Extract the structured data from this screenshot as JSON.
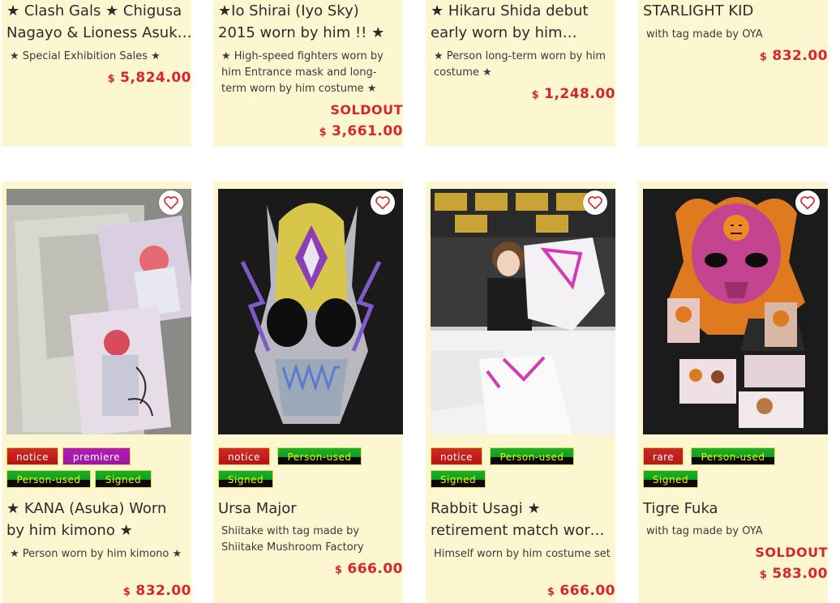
{
  "currency_symbol": "$",
  "top_row": [
    {
      "title": "★ Clash Gals ★ Chigusa Nagayo & Lioness Asuk…",
      "desc": "★ Special Exhibition Sales ★",
      "soldout": "",
      "price": "5,824.00"
    },
    {
      "title": "★Io Shirai (Iyo Sky) 2015 worn by him !! ★",
      "desc": "★ High-speed fighters worn by him Entrance mask and long-term worn by him costume ★",
      "soldout": "SOLDOUT",
      "price": "3,661.00"
    },
    {
      "title": "★ Hikaru Shida debut early worn by him Costu…",
      "desc": "★ Person long-term worn by him costume ★",
      "soldout": "",
      "price": "1,248.00"
    },
    {
      "title": "STARLIGHT KID",
      "desc": "with tag made by OYA",
      "soldout": "",
      "price": "832.00"
    }
  ],
  "products": [
    {
      "image_alt": "KANA kimono with signed photos",
      "tags_row1": [
        "notice",
        "premiere"
      ],
      "tags_row2": [
        "Person-used",
        "Signed"
      ],
      "title": "★ KANA (Asuka) Worn by him kimono ★",
      "desc": "★ Person worn by him kimono ★",
      "soldout": "",
      "price": "832.00"
    },
    {
      "image_alt": "Ursa Major gold and silver mask",
      "tags_row1": [
        "notice",
        "Person-used"
      ],
      "tags_row2": [
        "Signed"
      ],
      "title": "Ursa Major",
      "desc": "Shiitake with tag made by Shiitake Mushroom Factory",
      "soldout": "",
      "price": "666.00"
    },
    {
      "image_alt": "Rabbit Usagi holding white costume",
      "tags_row1": [
        "notice",
        "Person-used"
      ],
      "tags_row2": [
        "Signed"
      ],
      "title": "Rabbit Usagi ★ retirement match worn by him !…",
      "desc": "Himself worn by him costume set",
      "soldout": "",
      "price": "666.00"
    },
    {
      "image_alt": "Tigre Fuka orange furred mask with photos",
      "tags_row1": [
        "rare",
        "Person-used"
      ],
      "tags_row2": [
        "Signed"
      ],
      "title": "Tigre Fuka",
      "desc": "with tag made by OYA",
      "soldout": "SOLDOUT",
      "price": "583.00"
    }
  ],
  "colors": {
    "card_bg": "#fdf7d1",
    "price": "#d6262c",
    "tag_notice": "#c41a1a",
    "tag_premiere": "#a015a6",
    "tag_green": "#0fa021",
    "tag_text_green": "#f5f000"
  },
  "icons": {
    "favorite": "heart-outline-icon"
  }
}
